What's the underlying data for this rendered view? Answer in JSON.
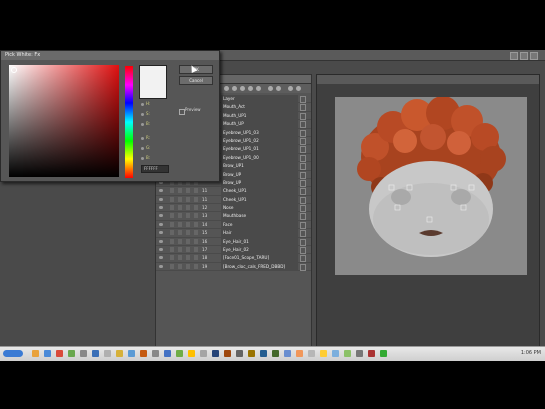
{
  "picker": {
    "title": "Pick White: Fx",
    "ok_label": "OK",
    "cancel_label": "Cancel",
    "fields": [
      "H:",
      "S:",
      "B:",
      "R:",
      "G:",
      "B:"
    ],
    "hex_value": "FFFFFF",
    "preview_label": "Preview"
  },
  "layers": {
    "rows": [
      {
        "name": "Layer"
      },
      {
        "name": "Mouth_Act"
      },
      {
        "name": "Mouth_UP1"
      },
      {
        "name": "Mouth_UP"
      },
      {
        "name": "Eyebrow_UP1_03"
      },
      {
        "name": "Eyebrow_UP1_02"
      },
      {
        "name": "Eyebrow_UP1_01"
      },
      {
        "name": "Eyebrow_UP1_00"
      },
      {
        "name": "Brow_UP1"
      },
      {
        "name": "Brow_UP"
      },
      {
        "name": "Brow_UP"
      },
      {
        "name": "Cheek_UP1",
        "num": "11"
      },
      {
        "name": "Cheek_UP1",
        "num": "11"
      },
      {
        "name": "Nose",
        "num": "12"
      },
      {
        "name": "Mouthbase",
        "num": "13"
      },
      {
        "name": "Face",
        "num": "14"
      },
      {
        "name": "Hair",
        "num": "15"
      },
      {
        "name": "Eye_Hair_01",
        "num": "16"
      },
      {
        "name": "Eye_Hair_02",
        "num": "17"
      },
      {
        "name": "[Face01_Scope_TARU]",
        "num": "18"
      },
      {
        "name": "[Brow_cloc_cals_FRED_DBBD]",
        "num": "19"
      }
    ]
  },
  "taskbar": {
    "clock": "1:06 PM"
  },
  "colors": {
    "hair": "#b84a25",
    "face": "#c8c8c8",
    "canvas": "#8a8a8a"
  }
}
